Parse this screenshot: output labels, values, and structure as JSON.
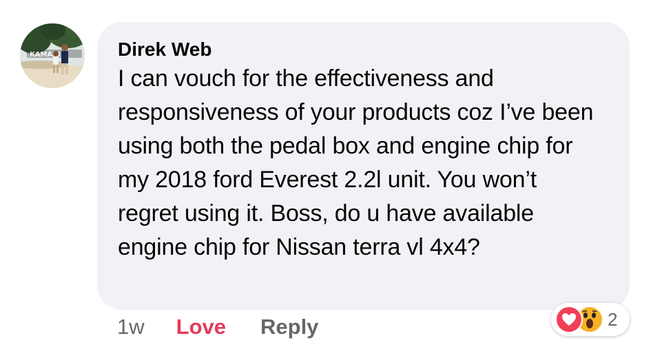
{
  "comment": {
    "author": "Direk Web",
    "text": "I can vouch for the effectiveness and responsiveness of your products coz I’ve been using both the pedal box and engine chip for my 2018 ford Everest 2.2l unit. You won’t regret using it. Boss, do u have available engine chip for Nissan terra vl 4x4?",
    "avatar_sign_text": "KAMARI"
  },
  "actions": {
    "time": "1w",
    "reaction_label": "Love",
    "reply_label": "Reply"
  },
  "reactions": {
    "icons": [
      "love-icon",
      "wow-icon"
    ],
    "count": "2",
    "colors": {
      "love": "#f33e58",
      "wow": "#f7b125",
      "love_text": "#e23c58"
    }
  },
  "colors": {
    "bubble": "#f0f2f5",
    "meta_text": "#65676b",
    "text": "#050505"
  }
}
